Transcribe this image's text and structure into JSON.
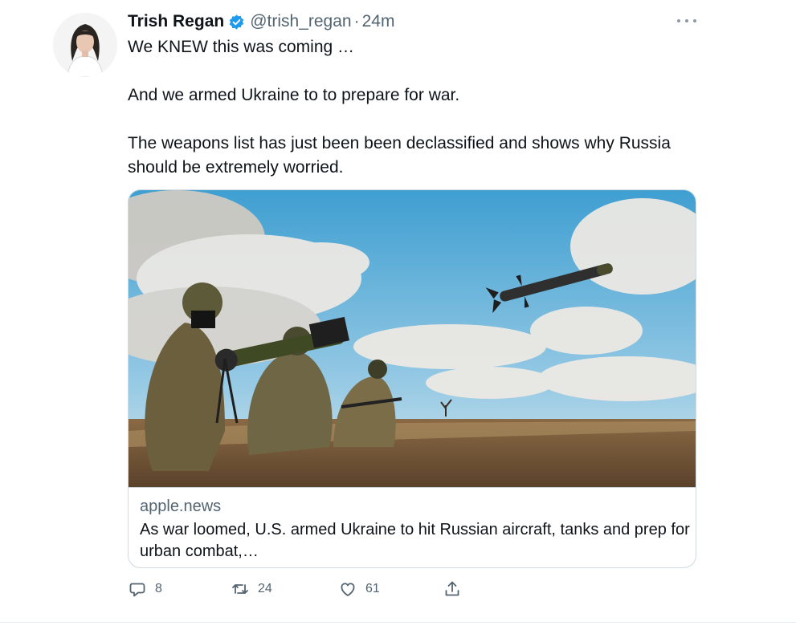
{
  "tweet": {
    "author_name": "Trish Regan",
    "handle": "@trish_regan",
    "separator": "·",
    "time": "24m",
    "verified": true,
    "text_lines": [
      "We KNEW this was coming …",
      "And we armed Ukraine to to prepare for war.",
      "The weapons list has just been been declassified and shows why Russia should be extremely worried."
    ]
  },
  "card": {
    "domain": "apple.news",
    "title": "As war loomed, U.S. armed Ukraine to hit Russian aircraft, tanks and prep for urban combat,…"
  },
  "actions": {
    "reply_count": "8",
    "retweet_count": "24",
    "like_count": "61"
  },
  "icons": [
    "verified-badge-icon",
    "more-icon",
    "reply-icon",
    "retweet-icon",
    "like-icon",
    "share-icon"
  ],
  "colors": {
    "verified": "#1d9bf0",
    "secondary_text": "#536471",
    "text": "#0f1419",
    "border": "#cfd9de"
  }
}
